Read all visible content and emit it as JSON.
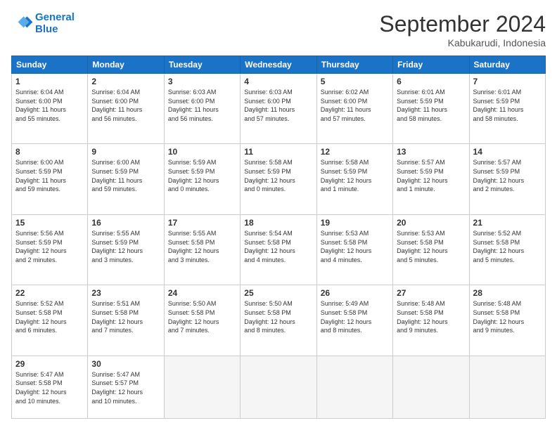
{
  "header": {
    "logo_line1": "General",
    "logo_line2": "Blue",
    "month": "September 2024",
    "location": "Kabukarudi, Indonesia"
  },
  "weekdays": [
    "Sunday",
    "Monday",
    "Tuesday",
    "Wednesday",
    "Thursday",
    "Friday",
    "Saturday"
  ],
  "weeks": [
    [
      {
        "day": "1",
        "info": "Sunrise: 6:04 AM\nSunset: 6:00 PM\nDaylight: 11 hours\nand 55 minutes."
      },
      {
        "day": "2",
        "info": "Sunrise: 6:04 AM\nSunset: 6:00 PM\nDaylight: 11 hours\nand 56 minutes."
      },
      {
        "day": "3",
        "info": "Sunrise: 6:03 AM\nSunset: 6:00 PM\nDaylight: 11 hours\nand 56 minutes."
      },
      {
        "day": "4",
        "info": "Sunrise: 6:03 AM\nSunset: 6:00 PM\nDaylight: 11 hours\nand 57 minutes."
      },
      {
        "day": "5",
        "info": "Sunrise: 6:02 AM\nSunset: 6:00 PM\nDaylight: 11 hours\nand 57 minutes."
      },
      {
        "day": "6",
        "info": "Sunrise: 6:01 AM\nSunset: 5:59 PM\nDaylight: 11 hours\nand 58 minutes."
      },
      {
        "day": "7",
        "info": "Sunrise: 6:01 AM\nSunset: 5:59 PM\nDaylight: 11 hours\nand 58 minutes."
      }
    ],
    [
      {
        "day": "8",
        "info": "Sunrise: 6:00 AM\nSunset: 5:59 PM\nDaylight: 11 hours\nand 59 minutes."
      },
      {
        "day": "9",
        "info": "Sunrise: 6:00 AM\nSunset: 5:59 PM\nDaylight: 11 hours\nand 59 minutes."
      },
      {
        "day": "10",
        "info": "Sunrise: 5:59 AM\nSunset: 5:59 PM\nDaylight: 12 hours\nand 0 minutes."
      },
      {
        "day": "11",
        "info": "Sunrise: 5:58 AM\nSunset: 5:59 PM\nDaylight: 12 hours\nand 0 minutes."
      },
      {
        "day": "12",
        "info": "Sunrise: 5:58 AM\nSunset: 5:59 PM\nDaylight: 12 hours\nand 1 minute."
      },
      {
        "day": "13",
        "info": "Sunrise: 5:57 AM\nSunset: 5:59 PM\nDaylight: 12 hours\nand 1 minute."
      },
      {
        "day": "14",
        "info": "Sunrise: 5:57 AM\nSunset: 5:59 PM\nDaylight: 12 hours\nand 2 minutes."
      }
    ],
    [
      {
        "day": "15",
        "info": "Sunrise: 5:56 AM\nSunset: 5:59 PM\nDaylight: 12 hours\nand 2 minutes."
      },
      {
        "day": "16",
        "info": "Sunrise: 5:55 AM\nSunset: 5:59 PM\nDaylight: 12 hours\nand 3 minutes."
      },
      {
        "day": "17",
        "info": "Sunrise: 5:55 AM\nSunset: 5:58 PM\nDaylight: 12 hours\nand 3 minutes."
      },
      {
        "day": "18",
        "info": "Sunrise: 5:54 AM\nSunset: 5:58 PM\nDaylight: 12 hours\nand 4 minutes."
      },
      {
        "day": "19",
        "info": "Sunrise: 5:53 AM\nSunset: 5:58 PM\nDaylight: 12 hours\nand 4 minutes."
      },
      {
        "day": "20",
        "info": "Sunrise: 5:53 AM\nSunset: 5:58 PM\nDaylight: 12 hours\nand 5 minutes."
      },
      {
        "day": "21",
        "info": "Sunrise: 5:52 AM\nSunset: 5:58 PM\nDaylight: 12 hours\nand 5 minutes."
      }
    ],
    [
      {
        "day": "22",
        "info": "Sunrise: 5:52 AM\nSunset: 5:58 PM\nDaylight: 12 hours\nand 6 minutes."
      },
      {
        "day": "23",
        "info": "Sunrise: 5:51 AM\nSunset: 5:58 PM\nDaylight: 12 hours\nand 7 minutes."
      },
      {
        "day": "24",
        "info": "Sunrise: 5:50 AM\nSunset: 5:58 PM\nDaylight: 12 hours\nand 7 minutes."
      },
      {
        "day": "25",
        "info": "Sunrise: 5:50 AM\nSunset: 5:58 PM\nDaylight: 12 hours\nand 8 minutes."
      },
      {
        "day": "26",
        "info": "Sunrise: 5:49 AM\nSunset: 5:58 PM\nDaylight: 12 hours\nand 8 minutes."
      },
      {
        "day": "27",
        "info": "Sunrise: 5:48 AM\nSunset: 5:58 PM\nDaylight: 12 hours\nand 9 minutes."
      },
      {
        "day": "28",
        "info": "Sunrise: 5:48 AM\nSunset: 5:58 PM\nDaylight: 12 hours\nand 9 minutes."
      }
    ],
    [
      {
        "day": "29",
        "info": "Sunrise: 5:47 AM\nSunset: 5:58 PM\nDaylight: 12 hours\nand 10 minutes."
      },
      {
        "day": "30",
        "info": "Sunrise: 5:47 AM\nSunset: 5:57 PM\nDaylight: 12 hours\nand 10 minutes."
      },
      {
        "day": "",
        "info": ""
      },
      {
        "day": "",
        "info": ""
      },
      {
        "day": "",
        "info": ""
      },
      {
        "day": "",
        "info": ""
      },
      {
        "day": "",
        "info": ""
      }
    ]
  ]
}
